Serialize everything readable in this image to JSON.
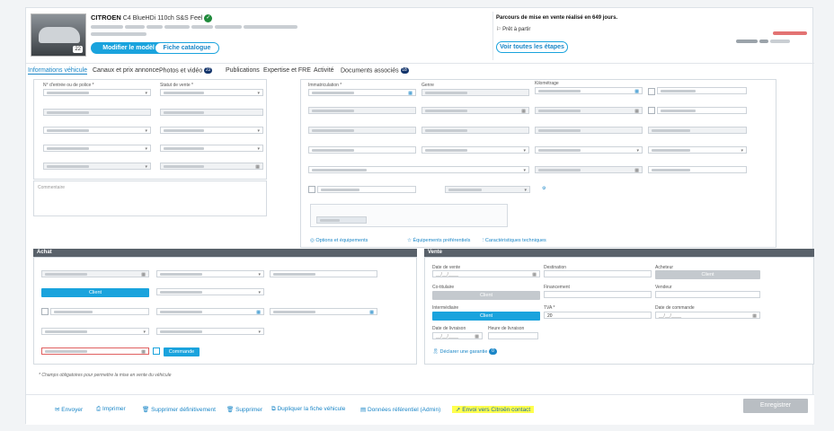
{
  "header": {
    "brand": "CITROEN",
    "model": "C4 BlueHDi 110ch S&S Feel",
    "photo_count": "22",
    "modify_label": "Modifier le modèle",
    "catalogue_label": "Fiche catalogue",
    "parcours_text": "Parcours de mise en vente réalisé en 649 jours.",
    "pret_text": "Prêt à partir",
    "steps_label": "Voir toutes les étapes"
  },
  "tabs": [
    {
      "label": "Informations véhicule"
    },
    {
      "label": "Canaux et prix annonce"
    },
    {
      "label": "Photos et vidéo",
      "count": "22"
    },
    {
      "label": "Publications"
    },
    {
      "label": "Expertise et FRE"
    },
    {
      "label": "Activité"
    },
    {
      "label": "Documents associés",
      "count": "18"
    }
  ],
  "form": {
    "entry_label": "N° d'entrée ou de police *",
    "statut_label": "Statut de vente *",
    "immat_label": "Immatriculation *",
    "genre_label": "Genre",
    "km_label": "Kilométrage",
    "commentaire_placeholder": "Commentaire",
    "options_link": "Options et équipements",
    "equip_link": "Équipements préférentiels",
    "carac_link": "Caractéristiques techniques"
  },
  "achat": {
    "title": "Achat",
    "client_btn": "Client",
    "commande_btn": "Commande"
  },
  "vente": {
    "title": "Vente",
    "date_vente_label": "Date de vente",
    "date_placeholder": "__/__/____",
    "destination_label": "Destination",
    "acheteur_label": "Acheteur",
    "client_label": "Client",
    "cotitulaire_label": "Co-titulaire",
    "financement_label": "Financement",
    "vendeur_label": "Vendeur",
    "intermediaire_label": "Intermédiaire",
    "tva_label": "TVA *",
    "tva_value": "20",
    "date_commande_label": "Date de commande",
    "date_livraison_label": "Date de livraison",
    "heure_livraison_label": "Heure de livraison",
    "garantie_label": "Déclarer une garantie",
    "garantie_count": "0"
  },
  "note": "* Champs obligatoires pour permettre la mise en vente du véhicule",
  "footer": {
    "envoyer": "Envoyer",
    "imprimer": "Imprimer",
    "supprimer_def": "Supprimer définitivement",
    "supprimer": "Supprimer",
    "dupliquer": "Dupliquer la fiche véhicule",
    "donnees": "Données référentiel (Admin)",
    "envoi": "Envoi vers Citroën contact",
    "enregistrer": "Enregistrer"
  }
}
